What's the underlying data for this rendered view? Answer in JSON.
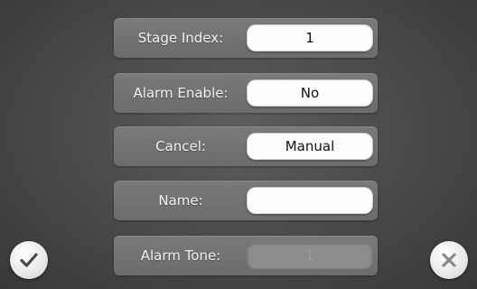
{
  "form": {
    "stage_index": {
      "label": "Stage Index:",
      "value": "1"
    },
    "alarm_enable": {
      "label": "Alarm Enable:",
      "value": "No"
    },
    "cancel": {
      "label": "Cancel:",
      "value": "Manual"
    },
    "name": {
      "label": "Name:",
      "value": ""
    },
    "alarm_tone": {
      "label": "Alarm Tone:",
      "value": "1",
      "enabled": false
    }
  },
  "buttons": {
    "confirm": {
      "icon": "checkmark-icon"
    },
    "close": {
      "icon": "close-icon"
    }
  },
  "colors": {
    "background": "#4a4a4a",
    "row": "#727272",
    "field": "#fdfdfd",
    "field_disabled": "#8c8c8c"
  }
}
